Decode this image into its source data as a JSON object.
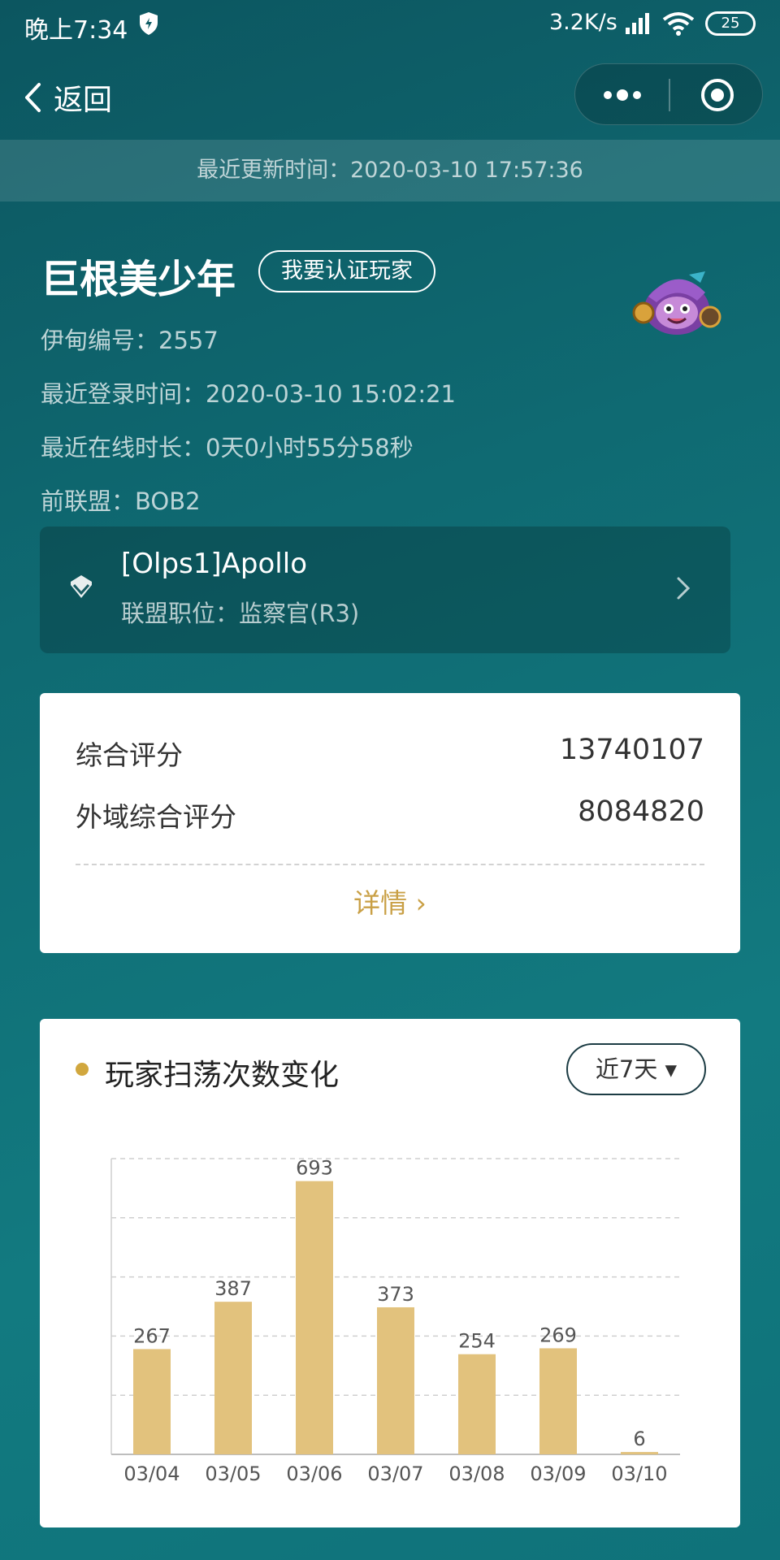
{
  "status_bar": {
    "time": "晚上7:34",
    "net_speed": "3.2K/s",
    "battery": "25",
    "icons": [
      "shield-icon",
      "signal-icon",
      "wifi-icon",
      "battery-icon"
    ]
  },
  "nav": {
    "back_label": "返回",
    "icons": [
      "chevron-left-icon",
      "more-icon",
      "close-circle-icon"
    ]
  },
  "update_bar": {
    "text": "最近更新时间：2020-03-10 17:57:36"
  },
  "profile": {
    "name": "巨根美少年",
    "verify_label": "我要认证玩家",
    "id_line": "伊甸编号：2557",
    "last_login": "最近登录时间：2020-03-10 15:02:21",
    "online_duration": "最近在线时长：0天0小时55分58秒",
    "former_alliance": "前联盟：BOB2"
  },
  "alliance": {
    "name": "[Olps1]Apollo",
    "role": "联盟职位：监察官(R3)"
  },
  "scores": {
    "overall_label": "综合评分",
    "overall_value": "13740107",
    "external_label": "外域综合评分",
    "external_value": "8084820",
    "details_label": "详情 ›"
  },
  "chart_section": {
    "title": "玩家扫荡次数变化",
    "range_label": "近7天 ▾",
    "accent": "#d1a73e",
    "bar_color": "#e2c27d"
  },
  "chart_data": {
    "type": "bar",
    "categories": [
      "03/04",
      "03/05",
      "03/06",
      "03/07",
      "03/08",
      "03/09",
      "03/10"
    ],
    "values": [
      267,
      387,
      693,
      373,
      254,
      269,
      6
    ],
    "ylim": [
      0,
      750
    ],
    "grid": true
  }
}
